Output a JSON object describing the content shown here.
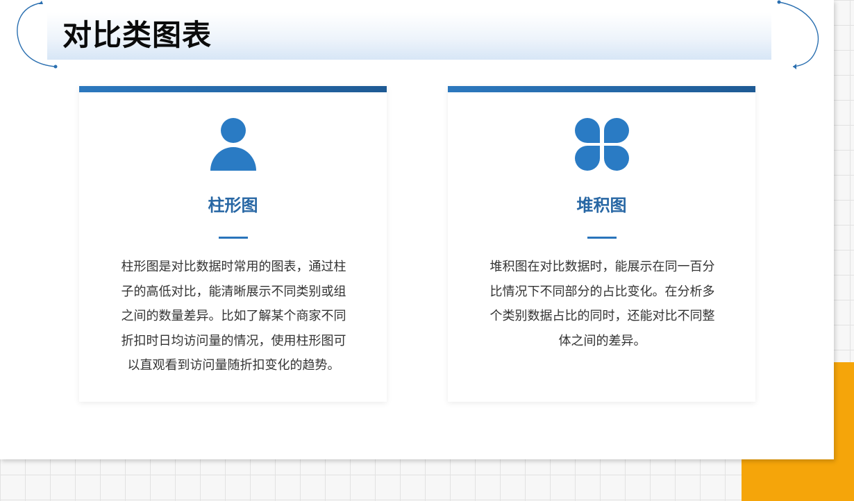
{
  "page": {
    "title": "对比类图表"
  },
  "colors": {
    "accent": "#2a7bc4",
    "title_blue": "#2867a4",
    "corner": "#f5a50a"
  },
  "cards": [
    {
      "icon": "person-icon",
      "title": "柱形图",
      "lines": [
        "柱形图是对比数据时常用的图表，通过柱",
        "子的高低对比，能清晰展示不同类别或组",
        "之间的数量差异。比如了解某个商家不同",
        "折扣时日均访问量的情况，使用柱形图可",
        "以直观看到访问量随折扣变化的趋势。"
      ]
    },
    {
      "icon": "four-petal-icon",
      "title": "堆积图",
      "lines": [
        "堆积图在对比数据时，能展示在同一百分",
        "比情况下不同部分的占比变化。在分析多",
        "个类别数据占比的同时，还能对比不同整",
        "体之间的差异。"
      ]
    }
  ]
}
